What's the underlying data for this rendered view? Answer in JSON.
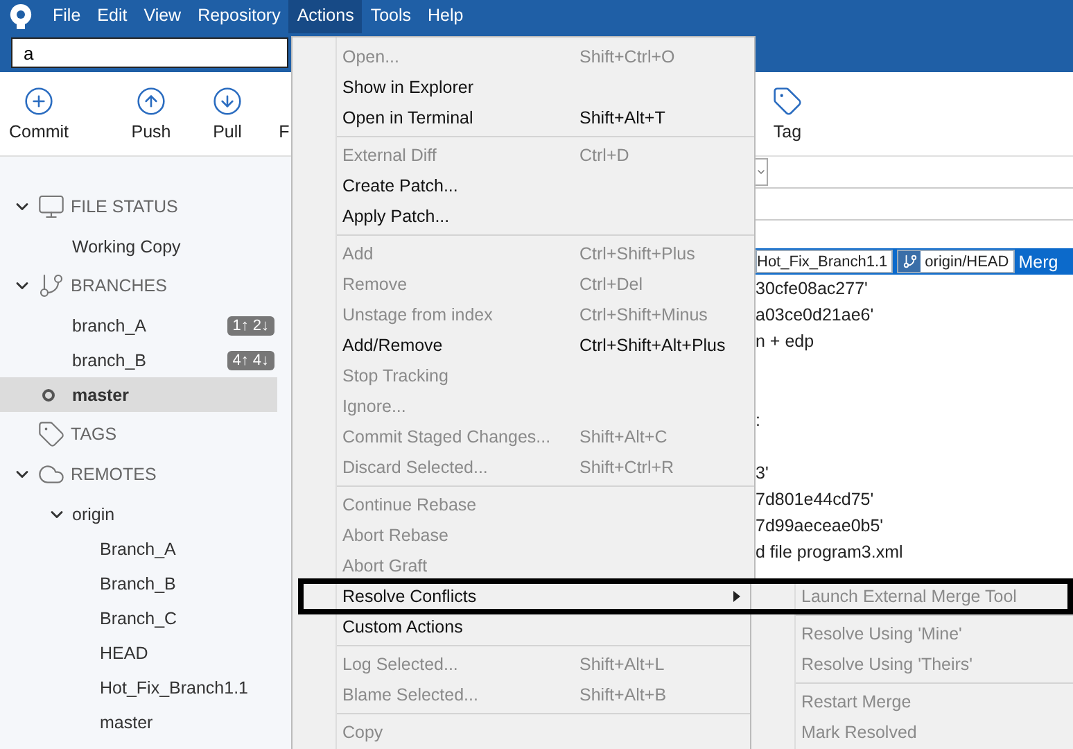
{
  "menubar": {
    "items": [
      {
        "label": "File",
        "selected": false
      },
      {
        "label": "Edit",
        "selected": false
      },
      {
        "label": "View",
        "selected": false
      },
      {
        "label": "Repository",
        "selected": false
      },
      {
        "label": "Actions",
        "selected": true
      },
      {
        "label": "Tools",
        "selected": false
      },
      {
        "label": "Help",
        "selected": false
      }
    ]
  },
  "search": {
    "value": "a"
  },
  "toolbar": {
    "left": [
      {
        "kind": "commit",
        "label": "Commit"
      },
      {
        "kind": "push",
        "label": "Push"
      },
      {
        "kind": "pull",
        "label": "Pull"
      },
      {
        "kind": "cut",
        "label": "F"
      }
    ],
    "right": [
      {
        "kind": "tag",
        "label": "Tag"
      }
    ]
  },
  "sidebar": {
    "sections": [
      {
        "kind": "status",
        "label": "FILE STATUS",
        "expanded": true,
        "children": [
          {
            "label": "Working Copy",
            "selected": false
          }
        ]
      },
      {
        "kind": "branches",
        "label": "BRANCHES",
        "expanded": true,
        "children": [
          {
            "label": "branch_A",
            "badge": "1↑ 2↓",
            "current": false,
            "selected": false
          },
          {
            "label": "branch_B",
            "badge": "4↑ 4↓",
            "current": false,
            "selected": false
          },
          {
            "label": "master",
            "current": true,
            "selected": true
          }
        ]
      },
      {
        "kind": "tags",
        "label": "TAGS"
      },
      {
        "kind": "remotes",
        "label": "REMOTES",
        "expanded": true,
        "children": [
          {
            "label": "origin",
            "expanded": true,
            "selected": false,
            "children": [
              {
                "label": "Branch_A"
              },
              {
                "label": "Branch_B"
              },
              {
                "label": "Branch_C"
              },
              {
                "label": "HEAD"
              },
              {
                "label": "Hot_Fix_Branch1.1"
              },
              {
                "label": "master"
              }
            ]
          }
        ]
      }
    ]
  },
  "commit_list": {
    "rows": [
      {
        "kind": "tags",
        "selected": true,
        "tags": [
          {
            "kind": "local",
            "label": "Hot_Fix_Branch1.1"
          },
          {
            "kind": "remote",
            "label": "origin/HEAD"
          }
        ],
        "text": "Merg"
      },
      {
        "kind": "text",
        "selected": false,
        "text": "30cfe08ac277'"
      },
      {
        "kind": "text",
        "selected": false,
        "text": "a03ce0d21ae6'"
      },
      {
        "kind": "text",
        "selected": false,
        "text": "n + edp"
      },
      {
        "kind": "blank"
      },
      {
        "kind": "blank"
      },
      {
        "kind": "text",
        "selected": false,
        "text": ":"
      },
      {
        "kind": "blank"
      },
      {
        "kind": "text",
        "selected": false,
        "text": "3'"
      },
      {
        "kind": "text",
        "selected": false,
        "text": "7d801e44cd75'"
      },
      {
        "kind": "text",
        "selected": false,
        "text": "7d99aeceae0b5'"
      },
      {
        "kind": "text",
        "selected": false,
        "text": "d file program3.xml"
      }
    ]
  },
  "actions_menu": {
    "sections": [
      [
        {
          "label": "Open...",
          "shortcut": "Shift+Ctrl+O",
          "disabled": true
        },
        {
          "label": "Show in Explorer",
          "disabled": false
        },
        {
          "label": "Open in Terminal",
          "shortcut": "Shift+Alt+T",
          "disabled": false
        }
      ],
      [
        {
          "label": "External Diff",
          "shortcut": "Ctrl+D",
          "disabled": true
        },
        {
          "label": "Create Patch...",
          "disabled": false
        },
        {
          "label": "Apply Patch...",
          "disabled": false
        }
      ],
      [
        {
          "label": "Add",
          "shortcut": "Ctrl+Shift+Plus",
          "disabled": true
        },
        {
          "label": "Remove",
          "shortcut": "Ctrl+Del",
          "disabled": true
        },
        {
          "label": "Unstage from index",
          "shortcut": "Ctrl+Shift+Minus",
          "disabled": true
        },
        {
          "label": "Add/Remove",
          "shortcut": "Ctrl+Shift+Alt+Plus",
          "disabled": false
        },
        {
          "label": "Stop Tracking",
          "disabled": true
        },
        {
          "label": "Ignore...",
          "disabled": true
        },
        {
          "label": "Commit Staged Changes...",
          "shortcut": "Shift+Alt+C",
          "disabled": true
        },
        {
          "label": "Discard Selected...",
          "shortcut": "Shift+Ctrl+R",
          "disabled": true
        }
      ],
      [
        {
          "label": "Continue Rebase",
          "disabled": true
        },
        {
          "label": "Abort Rebase",
          "disabled": true
        },
        {
          "label": "Abort Graft",
          "disabled": true
        },
        {
          "label": "Resolve Conflicts",
          "disabled": false,
          "submenu": true,
          "framed": true
        },
        {
          "label": "Custom Actions",
          "disabled": false
        }
      ],
      [
        {
          "label": "Log Selected...",
          "shortcut": "Shift+Alt+L",
          "disabled": true
        },
        {
          "label": "Blame Selected...",
          "shortcut": "Shift+Alt+B",
          "disabled": true
        }
      ],
      [
        {
          "label": "Copy",
          "disabled": true
        }
      ]
    ]
  },
  "submenu": {
    "sections": [
      [
        {
          "label": "Launch External Merge Tool",
          "disabled": true
        }
      ],
      [
        {
          "label": "Resolve Using 'Mine'",
          "disabled": true
        },
        {
          "label": "Resolve Using 'Theirs'",
          "disabled": true
        }
      ],
      [
        {
          "label": "Restart Merge",
          "disabled": true
        },
        {
          "label": "Mark Resolved",
          "disabled": true
        }
      ]
    ]
  }
}
